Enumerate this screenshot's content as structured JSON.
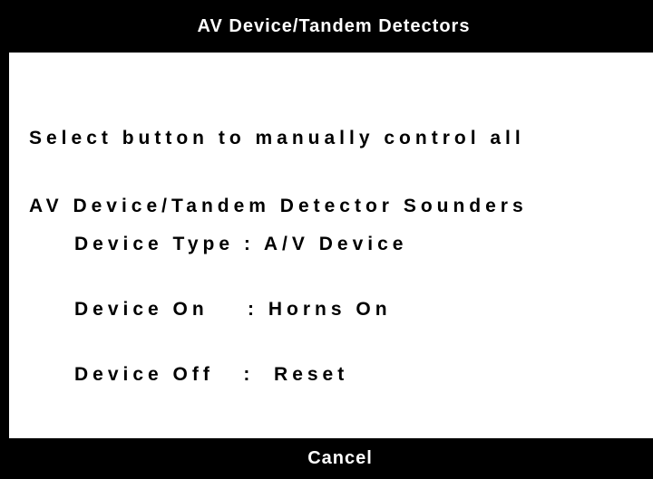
{
  "window": {
    "title": "AV Device/Tandem Detectors"
  },
  "instruction": {
    "line1": "Select button to manually control all",
    "line2": "AV Device/Tandem Detector Sounders"
  },
  "device_info": {
    "type_line": "Device Type : A/V Device",
    "on_line": "Device On    : Horns On",
    "off_line": "Device Off   :  Reset"
  },
  "footer": {
    "cancel_label": "Cancel"
  },
  "colors": {
    "background": "#000000",
    "panel": "#ffffff",
    "text_on_dark": "#ffffff",
    "text_on_light": "#000000"
  }
}
